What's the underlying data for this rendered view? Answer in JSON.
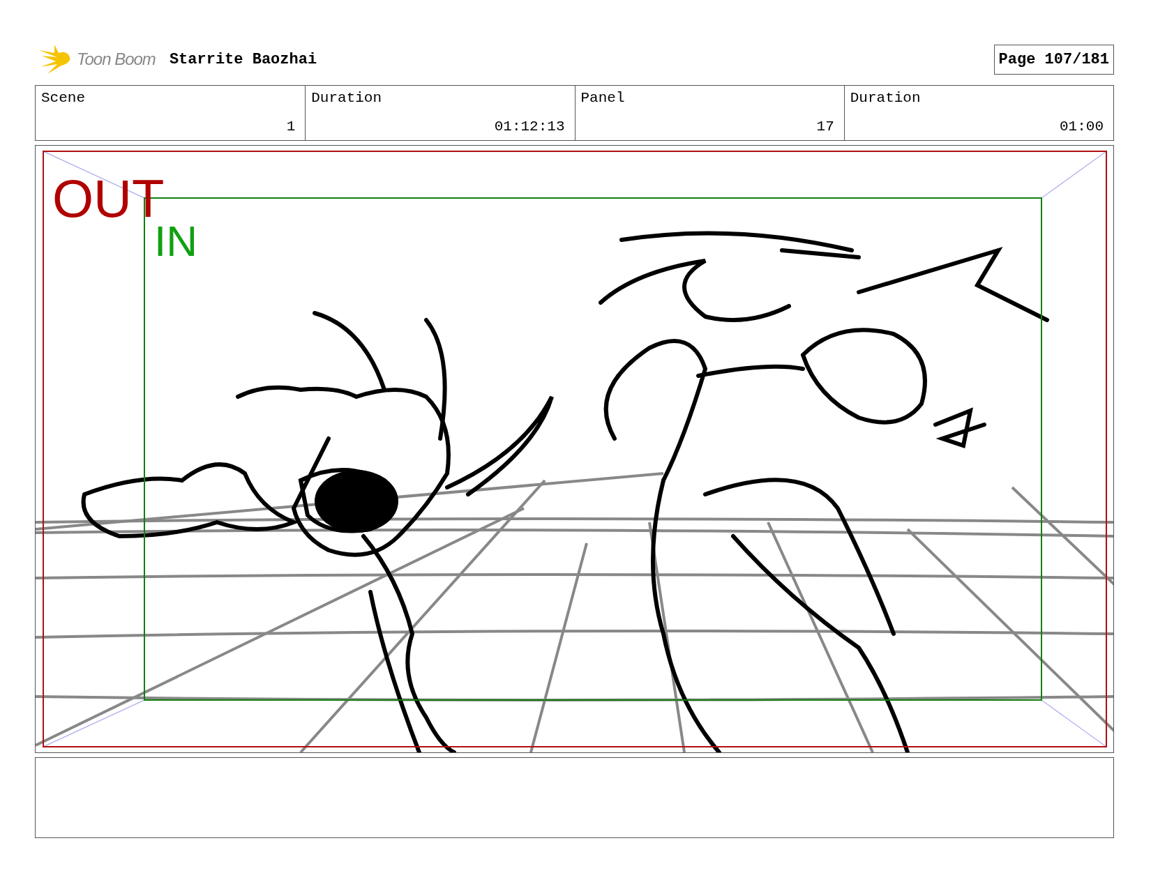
{
  "header": {
    "logo_text": "Toon Boom",
    "title": "Starrite Baozhai",
    "page": "Page 107/181"
  },
  "fields": [
    {
      "label": "Scene",
      "value": "1"
    },
    {
      "label": "Duration",
      "value": "01:12:13"
    },
    {
      "label": "Panel",
      "value": "17"
    },
    {
      "label": "Duration",
      "value": "01:00"
    }
  ],
  "panel": {
    "out_label": "OUT",
    "in_label": "IN"
  }
}
